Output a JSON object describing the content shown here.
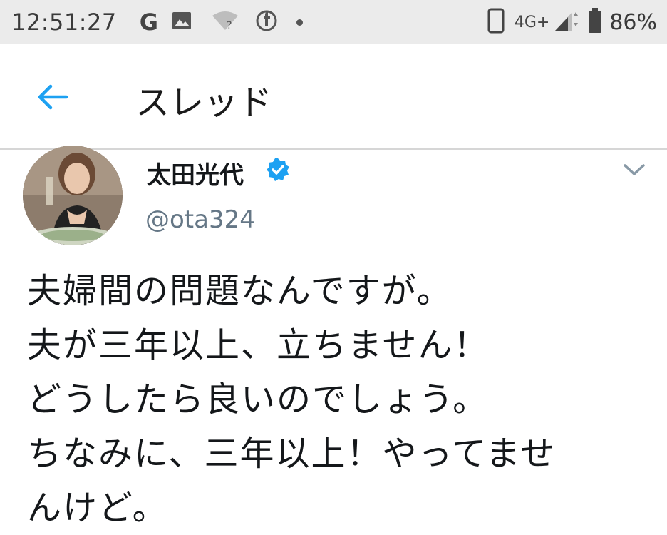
{
  "status_bar": {
    "time": "12:51:27",
    "g_label": "G",
    "network_type": "4G+",
    "battery_percent": "86%",
    "icons": [
      "google-icon",
      "image-icon",
      "wifi-unknown-icon",
      "facebook-icon",
      "notification-dot-icon",
      "phone-icon",
      "signal-icon",
      "battery-icon"
    ]
  },
  "app_bar": {
    "back_icon": "back-arrow-icon",
    "title": "スレッド"
  },
  "tweet": {
    "author_name": "太田光代",
    "verified_icon": "verified-badge-icon",
    "handle": "@ota324",
    "caret_icon": "chevron-down-icon",
    "lines": [
      "夫婦間の問題なんですが。",
      "夫が三年以上、立ちません！",
      "どうしたら良いのでしょう。",
      "ちなみに、三年以上！やってませ",
      "んけど。"
    ]
  },
  "colors": {
    "accent_blue": "#1da1f2",
    "status_bar_bg": "#ebebeb",
    "handle_gray": "#657786",
    "text": "#14171a"
  }
}
